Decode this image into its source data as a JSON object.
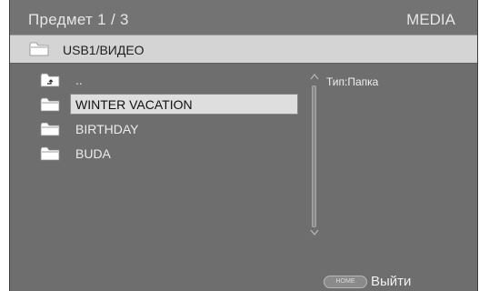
{
  "header": {
    "title": "Предмет",
    "page_indicator": "1 / 3",
    "mode": "MEDIA"
  },
  "path": {
    "current": "USB1/ВИДЕО"
  },
  "list": {
    "items": [
      {
        "label": "..",
        "icon": "folder-up-icon",
        "selected": false
      },
      {
        "label": "WINTER VACATION",
        "icon": "folder-icon",
        "selected": true
      },
      {
        "label": "BIRTHDAY",
        "icon": "folder-icon",
        "selected": false
      },
      {
        "label": "BUDA",
        "icon": "folder-icon",
        "selected": false
      }
    ]
  },
  "info": {
    "type_text": "Тип:Папка"
  },
  "footer": {
    "home_button_label": "HOME",
    "exit_label": "Выйти"
  },
  "colors": {
    "background": "#6e6e6e",
    "path_bar": "#d4d4d4",
    "selection": "#dedede",
    "text_light": "#ececec"
  }
}
